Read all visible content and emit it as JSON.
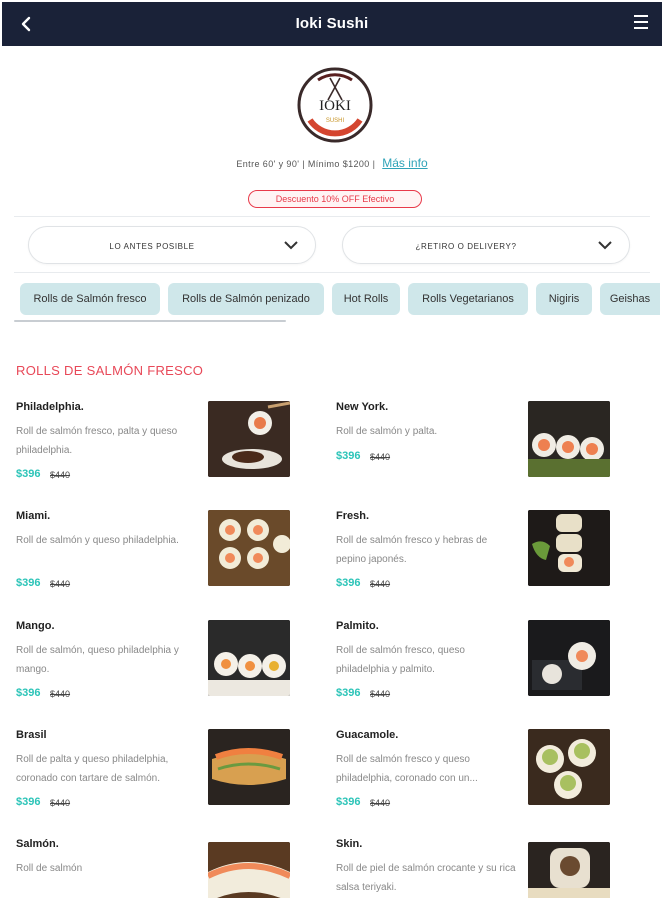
{
  "header": {
    "title": "Ioki Sushi"
  },
  "logo": {
    "main": "IOKI",
    "sub": "SUSHI"
  },
  "info": {
    "text": "Entre 60' y 90' | Mínimo $1200 |",
    "link": "Más info"
  },
  "discount": "Descuento 10% OFF Efectivo",
  "selectors": {
    "time": "LO ANTES POSIBLE",
    "delivery": "¿RETIRO O DELIVERY?"
  },
  "categories": [
    "Rolls de Salmón fresco",
    "Rolls de Salmón penizado",
    "Hot Rolls",
    "Rolls Vegetarianos",
    "Nigiris",
    "Geishas"
  ],
  "section_title": "ROLLS DE SALMÓN FRESCO",
  "products": [
    {
      "name": "Philadelphia.",
      "desc": "Roll de salmón fresco, palta y queso philadelphia.",
      "price": "$396",
      "old_price": "$440"
    },
    {
      "name": "New York.",
      "desc": "Roll de salmón y palta.",
      "price": "$396",
      "old_price": "$440"
    },
    {
      "name": "Miami.",
      "desc": "Roll de salmón y queso philadelphia.",
      "price": "$396",
      "old_price": "$440"
    },
    {
      "name": "Fresh.",
      "desc": "Roll de salmón fresco y hebras de pepino japonés.",
      "price": "$396",
      "old_price": "$440"
    },
    {
      "name": "Mango.",
      "desc": "Roll de salmón, queso philadelphia y mango.",
      "price": "$396",
      "old_price": "$440"
    },
    {
      "name": "Palmito.",
      "desc": "Roll de salmón fresco, queso philadelphia y palmito.",
      "price": "$396",
      "old_price": "$440"
    },
    {
      "name": "Brasil",
      "desc": "Roll de palta y queso philadelphia, coronado con tartare de salmón.",
      "price": "$396",
      "old_price": "$440"
    },
    {
      "name": "Guacamole.",
      "desc": "Roll de salmón fresco y queso philadelphia, coronado con un...",
      "price": "$396",
      "old_price": "$440"
    },
    {
      "name": "Salmón.",
      "desc": "Roll de salmón",
      "price": "",
      "old_price": ""
    },
    {
      "name": "Skin.",
      "desc": "Roll de piel de salmón crocante y su rica salsa teriyaki.",
      "price": "",
      "old_price": ""
    }
  ],
  "colors": {
    "header_bg": "#1a2238",
    "accent_red": "#e84858",
    "price_teal": "#2cc4b8",
    "chip_bg": "#cfe7ea",
    "link": "#2fa3b8"
  }
}
